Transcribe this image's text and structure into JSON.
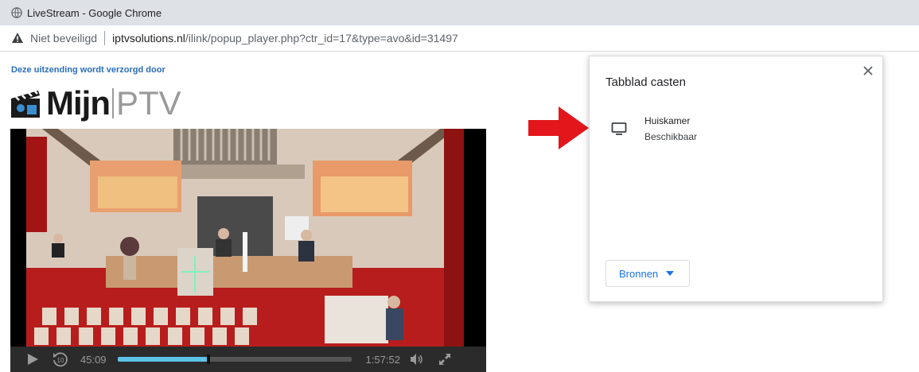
{
  "window": {
    "title": "LiveStream - Google Chrome"
  },
  "address_bar": {
    "security_label": "Niet beveiligd",
    "url_host": "iptvsolutions.nl",
    "url_path": "/ilink/popup_player.php?ctr_id=17&type=avo&id=31497"
  },
  "page": {
    "sponsor_text": "Deze uitzending wordt verzorgd door",
    "logo_bold": "Mijn",
    "logo_light": "PTV"
  },
  "player": {
    "elapsed": "45:09",
    "duration": "1:57:52",
    "progress": 0.383,
    "rewind_seconds": "10"
  },
  "cast_dialog": {
    "title": "Tabblad casten",
    "devices": [
      {
        "name": "Huiskamer",
        "status": "Beschikbaar",
        "icon": "tv-icon"
      }
    ],
    "sources_button": "Bronnen"
  },
  "colors": {
    "accent_blue": "#1a73e8",
    "progress_fill": "#5bc4e8",
    "arrow_red": "#e3161b",
    "sponsor_blue": "#2a6ebb"
  }
}
